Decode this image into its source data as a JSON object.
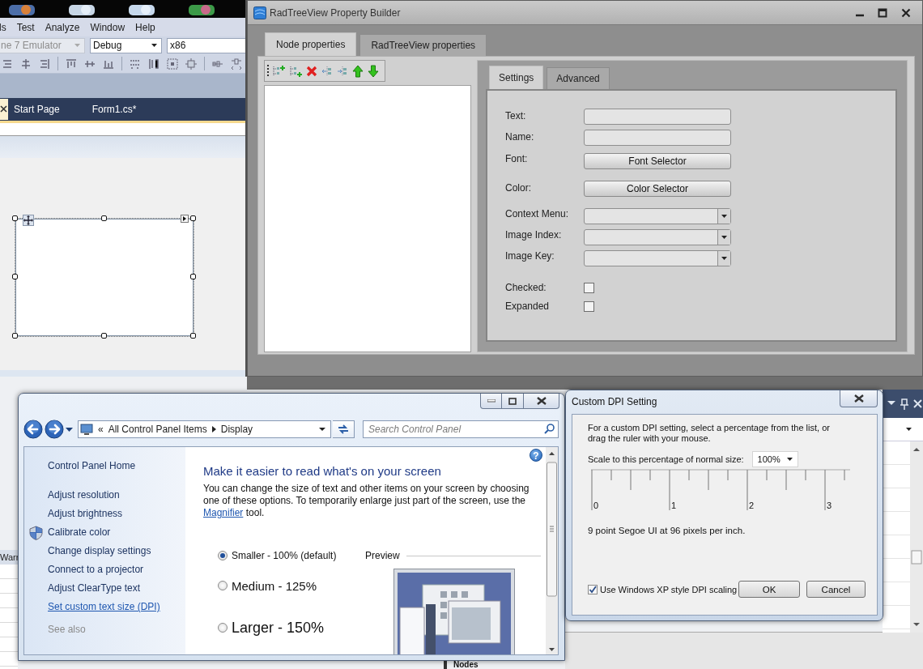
{
  "background": {
    "warn_text": "Warr",
    "nodes_text": "Nodes"
  },
  "vs_window": {
    "menu": [
      {
        "label": "ls"
      },
      {
        "label": "Test"
      },
      {
        "label": "Analyze"
      },
      {
        "label": "Window"
      },
      {
        "label": "Help"
      }
    ],
    "combos": [
      {
        "value": "ne 7 Emulator",
        "disabled": true,
        "kind": "dropdown"
      },
      {
        "value": "Debug",
        "disabled": false,
        "kind": "dropdown"
      },
      {
        "value": "x86",
        "disabled": false,
        "kind": "field"
      }
    ],
    "doc_tabs": [
      {
        "label": "Start Page"
      },
      {
        "label": "Form1.cs*"
      }
    ]
  },
  "property_builder": {
    "title": "RadTreeView Property Builder",
    "tabs": [
      {
        "label": "Node properties",
        "selected": true
      },
      {
        "label": "RadTreeView properties",
        "selected": false
      }
    ],
    "settings_tabs": [
      {
        "label": "Settings",
        "selected": true
      },
      {
        "label": "Advanced",
        "selected": false
      }
    ],
    "fields": [
      {
        "label": "Text:",
        "kind": "text"
      },
      {
        "label": "Name:",
        "kind": "text"
      },
      {
        "label": "Font:",
        "kind": "button",
        "button": "Font Selector"
      },
      {
        "label": "Color:",
        "kind": "button",
        "button": "Color Selector"
      },
      {
        "label": "Context Menu:",
        "kind": "combo"
      },
      {
        "label": "Image Index:",
        "kind": "combo"
      },
      {
        "label": "Image Key:",
        "kind": "combo"
      },
      {
        "label": "Checked:",
        "kind": "checkbox",
        "checked": false
      },
      {
        "label": "Expanded",
        "kind": "checkbox",
        "checked": false
      }
    ]
  },
  "control_panel": {
    "overflow_glyph": "«",
    "breadcrumb": [
      "All Control Panel Items",
      "Display"
    ],
    "search_placeholder": "Search Control Panel",
    "help_glyph": "?",
    "sidebar": [
      {
        "label": "Control Panel Home",
        "kind": "home"
      },
      {
        "label": "Adjust resolution",
        "kind": "task"
      },
      {
        "label": "Adjust brightness",
        "kind": "task"
      },
      {
        "label": "Calibrate color",
        "kind": "admin"
      },
      {
        "label": "Change display settings",
        "kind": "task"
      },
      {
        "label": "Connect to a projector",
        "kind": "task"
      },
      {
        "label": "Adjust ClearType text",
        "kind": "task"
      },
      {
        "label": "Set custom text size (DPI)",
        "kind": "link"
      },
      {
        "label": "See also",
        "kind": "header"
      }
    ],
    "heading": "Make it easier to read what's on your screen",
    "intro": "You can change the size of text and other items on your screen by choosing one of these options. To temporarily enlarge just part of the screen, use the ",
    "link": "Magnifier",
    "intro_end": " tool.",
    "options": [
      {
        "label": "Smaller - 100% (default)",
        "kind": "small",
        "selected": true
      },
      {
        "label": "Medium - 125%",
        "kind": "medium",
        "selected": false
      },
      {
        "label": "Larger - 150%",
        "kind": "large",
        "selected": false
      }
    ],
    "preview_label": "Preview"
  },
  "dpi_dialog": {
    "title": "Custom DPI Setting",
    "description": "For a custom DPI setting, select a percentage from the list, or drag the ruler with your mouse.",
    "scale_label": "Scale to this percentage of normal size:",
    "scale_value": "100%",
    "ruler_labels": [
      "0",
      "1",
      "2",
      "3"
    ],
    "info": "9 point Segoe UI at 96 pixels per inch.",
    "xp_scaling": {
      "label": "Use Windows XP style DPI scaling",
      "checked": true
    },
    "buttons": [
      "OK",
      "Cancel"
    ]
  }
}
